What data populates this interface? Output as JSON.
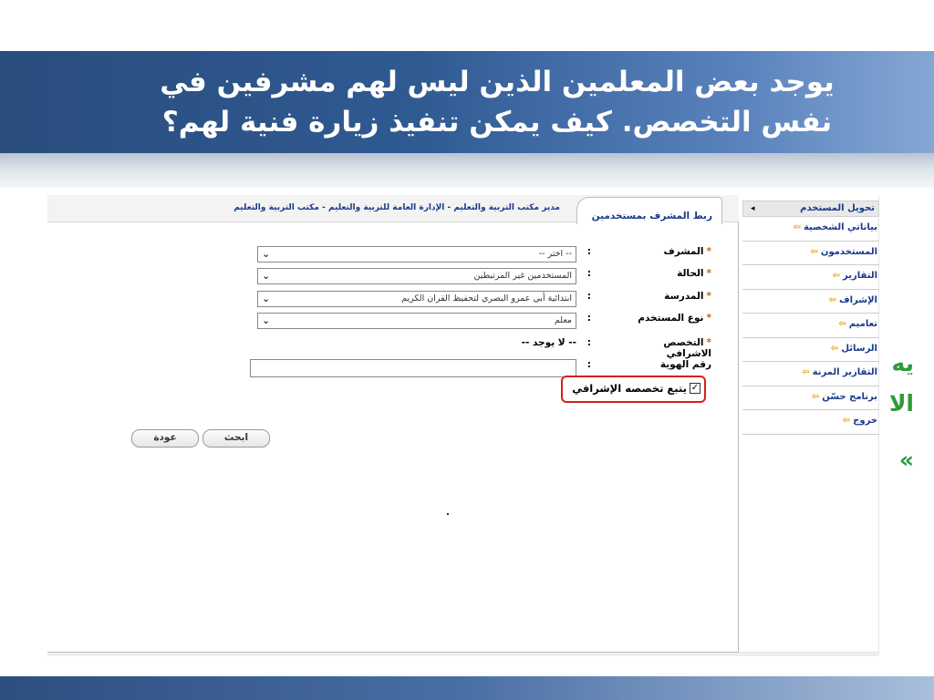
{
  "slide": {
    "title": "يوجد بعض المعلمين الذين ليس لهم مشرفين في نفس التخصص. كيف يمكن تنفيذ زيارة فنية لهم؟",
    "edge_fragments": [
      "يه",
      "الا",
      "»"
    ]
  },
  "sidebar": {
    "header": "تحويل المستخدم",
    "items": [
      {
        "label": "بياناتي الشخصية"
      },
      {
        "label": "المستخدمون"
      },
      {
        "label": "التقارير"
      },
      {
        "label": "الإشراف"
      },
      {
        "label": "تعاميم"
      },
      {
        "label": "الرسائل"
      },
      {
        "label": "التقارير المرنة"
      },
      {
        "label": "برنامج حسّن"
      },
      {
        "label": "خروج"
      }
    ]
  },
  "tab": {
    "label": "ربط المشرف بمستخدمين"
  },
  "breadcrumb": "مدير مكتب التربية والتعليم - الإدارة العامة للتربية والتعليم - مكتب التربية والتعليم",
  "form": {
    "supervisor": {
      "label": "المشرف",
      "value": "-- اختر --"
    },
    "status": {
      "label": "الحالة",
      "value": "المستخدمين غير المرتبطين"
    },
    "school": {
      "label": "المدرسة",
      "value": "ابتدائية أبي عمرو البصري لتحفيظ القران الكريم"
    },
    "user_type": {
      "label": "نوع المستخدم",
      "value": "معلم"
    },
    "supervisory_specialty": {
      "label": "التخصص الاشرافي",
      "value": "-- لا يوجد --"
    },
    "id_number": {
      "label": "رقم الهوية",
      "value": ""
    },
    "follow_specialty": {
      "label": "يتبع تخصصه الإشرافي",
      "checked": true
    },
    "colon": ":",
    "required_mark": "*"
  },
  "buttons": {
    "search": "ابحث",
    "back": "عودة"
  },
  "colors": {
    "title_band": "#2f5a92",
    "link_blue": "#1a3a8a",
    "highlight_red": "#d81e1e",
    "edge_green": "#2f9a3a"
  }
}
